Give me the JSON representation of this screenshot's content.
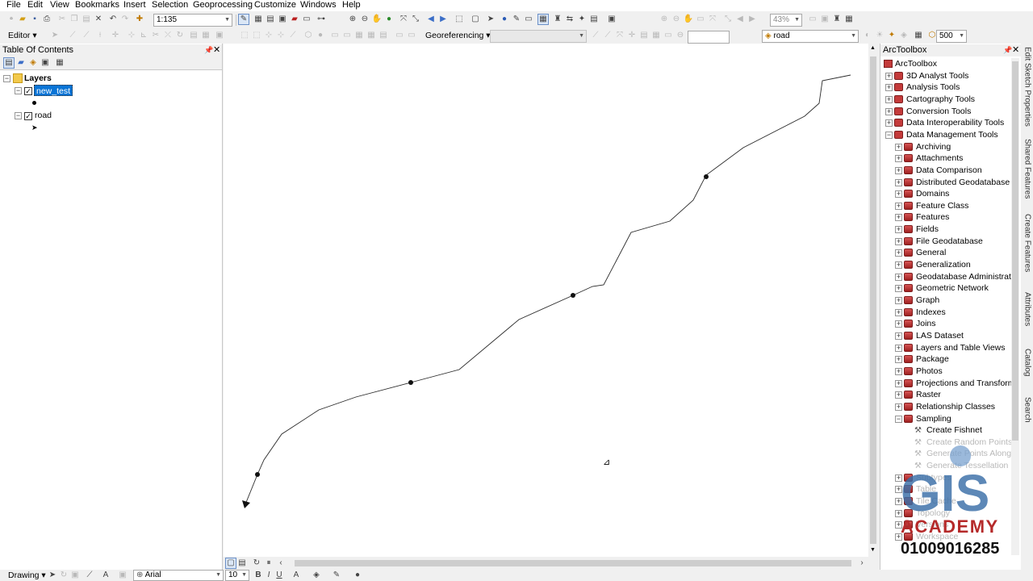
{
  "menu": [
    "File",
    "Edit",
    "View",
    "Bookmarks",
    "Insert",
    "Selection",
    "Geoprocessing",
    "Customize",
    "Windows",
    "Help"
  ],
  "toolbar": {
    "scale": "1:135",
    "editor_label": "Editor",
    "georef_label": "Georeferencing",
    "layer_select": "road",
    "zoom_percent": "43%",
    "snap_value": "500"
  },
  "toc": {
    "title": "Table Of Contents",
    "root": "Layers",
    "layers": [
      {
        "name": "new_test",
        "selected": true,
        "symbol": "point"
      },
      {
        "name": "road",
        "selected": false,
        "symbol": "arrow"
      }
    ]
  },
  "toolbox": {
    "title": "ArcToolbox",
    "root": "ArcToolbox",
    "top_items": [
      "3D Analyst Tools",
      "Analysis Tools",
      "Cartography Tools",
      "Conversion Tools",
      "Data Interoperability Tools",
      "Data Management Tools"
    ],
    "dm_children": [
      "Archiving",
      "Attachments",
      "Data Comparison",
      "Distributed Geodatabase",
      "Domains",
      "Feature Class",
      "Features",
      "Fields",
      "File Geodatabase",
      "General",
      "Generalization",
      "Geodatabase Administrati",
      "Geometric Network",
      "Graph",
      "Indexes",
      "Joins",
      "LAS Dataset",
      "Layers and Table Views",
      "Package",
      "Photos",
      "Projections and Transform",
      "Raster",
      "Relationship Classes",
      "Sampling"
    ],
    "sampling_tools": [
      "Create Fishnet",
      "Create Random Points",
      "Generate Points Along",
      "Generate Tessellation"
    ],
    "faded_items": [
      "Subtypes",
      "Table",
      "Tile Cache",
      "Topology",
      "Versions",
      "Workspace"
    ]
  },
  "side_tabs": [
    "Edit Sketch Properties",
    "Shared Features",
    "Create Features",
    "Attributes",
    "Catalog",
    "Search"
  ],
  "watermark": {
    "logo": "GIS",
    "subtitle": "ACADEMY",
    "phone": "01009016285",
    "color_blue": "#3a6fa8",
    "color_red": "#b52a2a"
  },
  "drawing_bar": {
    "drawing_label": "Drawing",
    "font": "Arial",
    "font_size": "10",
    "bold": "B",
    "italic": "I",
    "underline": "U"
  },
  "colors": {
    "selection": "#0a74d6",
    "toolbox_red": "#c43b3b"
  }
}
